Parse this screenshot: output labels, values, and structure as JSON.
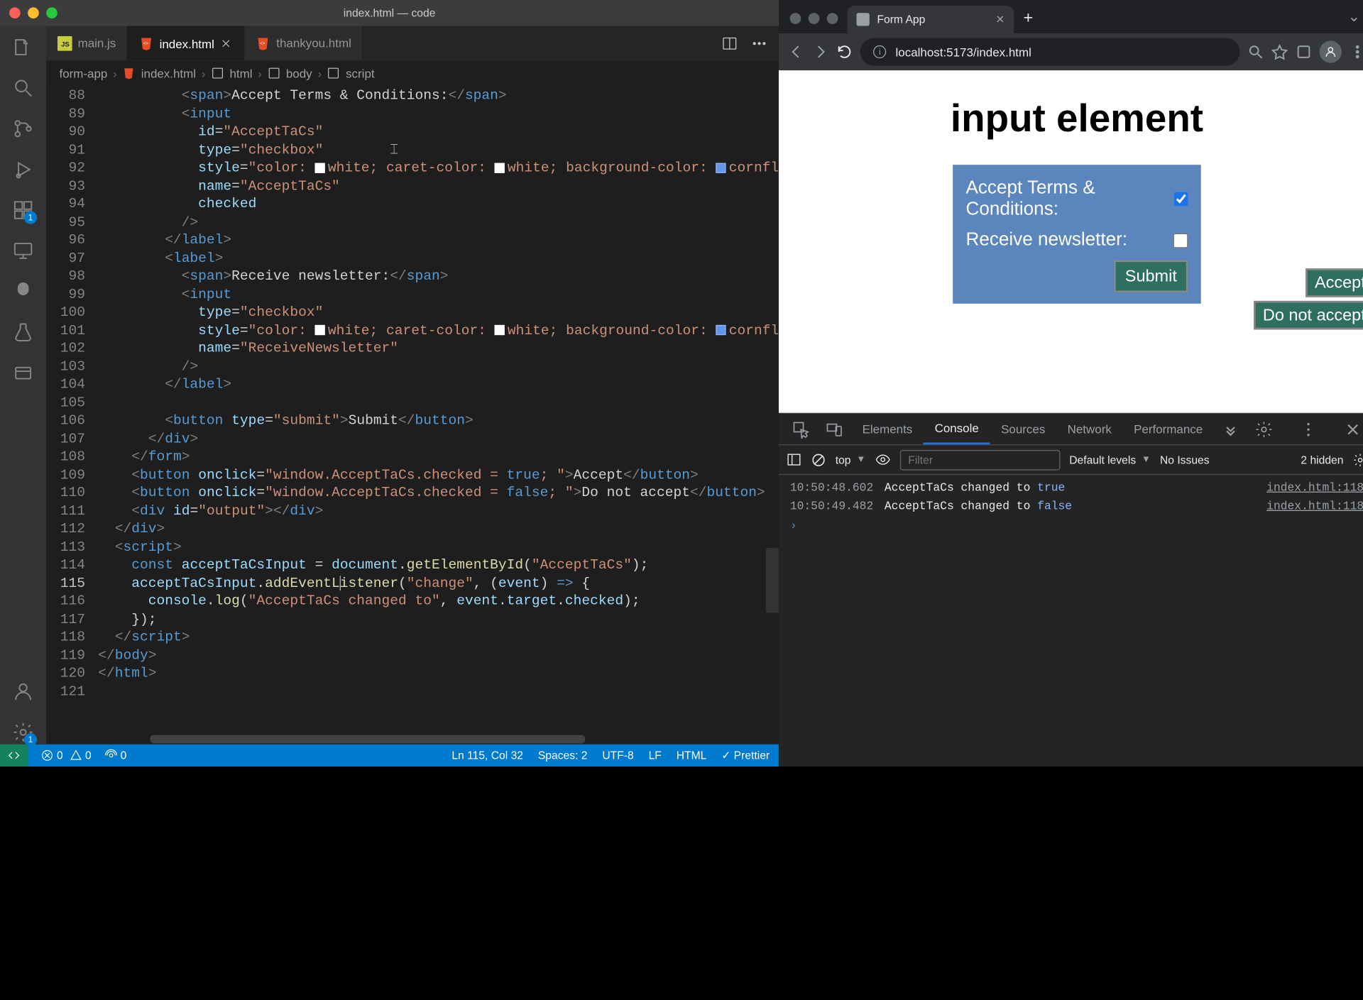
{
  "vscode": {
    "window_title": "index.html — code",
    "tabs": [
      {
        "label": "main.js",
        "icon": "js"
      },
      {
        "label": "index.html",
        "icon": "html",
        "active": true,
        "dirty": false
      },
      {
        "label": "thankyou.html",
        "icon": "html"
      }
    ],
    "breadcrumb": [
      "form-app",
      "index.html",
      "html",
      "body",
      "script"
    ],
    "activity_badges": {
      "extensions": "1",
      "settings": "1"
    },
    "status": {
      "errors": "0",
      "warnings": "0",
      "ports": "0",
      "lncol": "Ln 115, Col 32",
      "spaces": "Spaces: 2",
      "encoding": "UTF-8",
      "eol": "LF",
      "lang": "HTML",
      "prettier": "Prettier"
    },
    "line_start": 88,
    "line_end": 121,
    "current_line": 115
  },
  "browser": {
    "tab_title": "Form App",
    "url": "localhost:5173/index.html"
  },
  "page": {
    "heading": "input element",
    "rows": [
      {
        "label": "Accept Terms & Conditions:",
        "checked": true
      },
      {
        "label": "Receive newsletter:",
        "checked": false
      }
    ],
    "submit": "Submit",
    "side": [
      "Accept",
      "Do not accept"
    ]
  },
  "devtools": {
    "tabs": [
      "Elements",
      "Console",
      "Sources",
      "Network",
      "Performance"
    ],
    "active_tab": "Console",
    "context": "top",
    "filter_placeholder": "Filter",
    "levels": "Default levels",
    "issues": "No Issues",
    "hidden": "2 hidden",
    "logs": [
      {
        "ts": "10:50:48.602",
        "msg": "AcceptTaCs changed to",
        "val": "true",
        "src": "index.html:118"
      },
      {
        "ts": "10:50:49.482",
        "msg": "AcceptTaCs changed to",
        "val": "false",
        "src": "index.html:118"
      }
    ]
  },
  "chart_data": null
}
